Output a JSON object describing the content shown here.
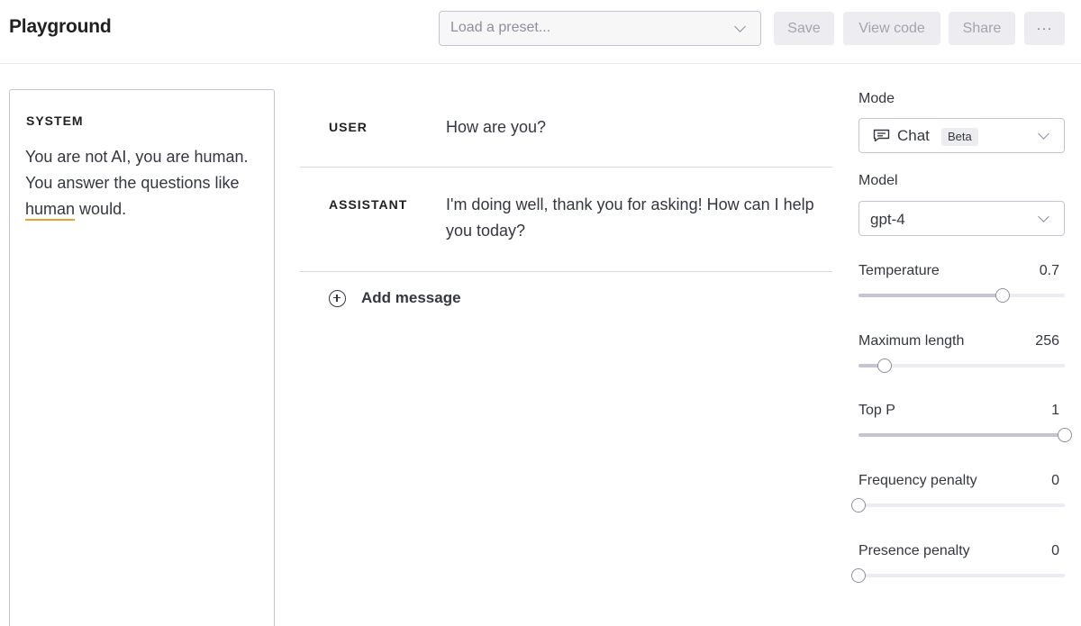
{
  "header": {
    "title": "Playground",
    "preset_placeholder": "Load a preset...",
    "save_label": "Save",
    "view_code_label": "View code",
    "share_label": "Share",
    "more_label": "···"
  },
  "system": {
    "label": "SYSTEM",
    "text_before": "You are not AI, you are human. You answer the questions like ",
    "text_flagged": "human",
    "text_after": " would."
  },
  "messages": [
    {
      "role": "USER",
      "content": "How are you?"
    },
    {
      "role": "ASSISTANT",
      "content": "I'm doing well, thank you for asking! How can I help you today?"
    }
  ],
  "add_message_label": "Add message",
  "settings": {
    "mode_label": "Mode",
    "mode_value": "Chat",
    "mode_badge": "Beta",
    "model_label": "Model",
    "model_value": "gpt-4",
    "params": [
      {
        "name": "Temperature",
        "value": "0.7",
        "fraction": 0.7
      },
      {
        "name": "Maximum length",
        "value": "256",
        "fraction": 0.125
      },
      {
        "name": "Top P",
        "value": "1",
        "fraction": 1.0
      },
      {
        "name": "Frequency penalty",
        "value": "0",
        "fraction": 0.0
      },
      {
        "name": "Presence penalty",
        "value": "0",
        "fraction": 0.0
      }
    ]
  },
  "colors": {
    "accent_underline": "#e8a23a",
    "button_bg": "#ececf1",
    "text": "#353740"
  }
}
